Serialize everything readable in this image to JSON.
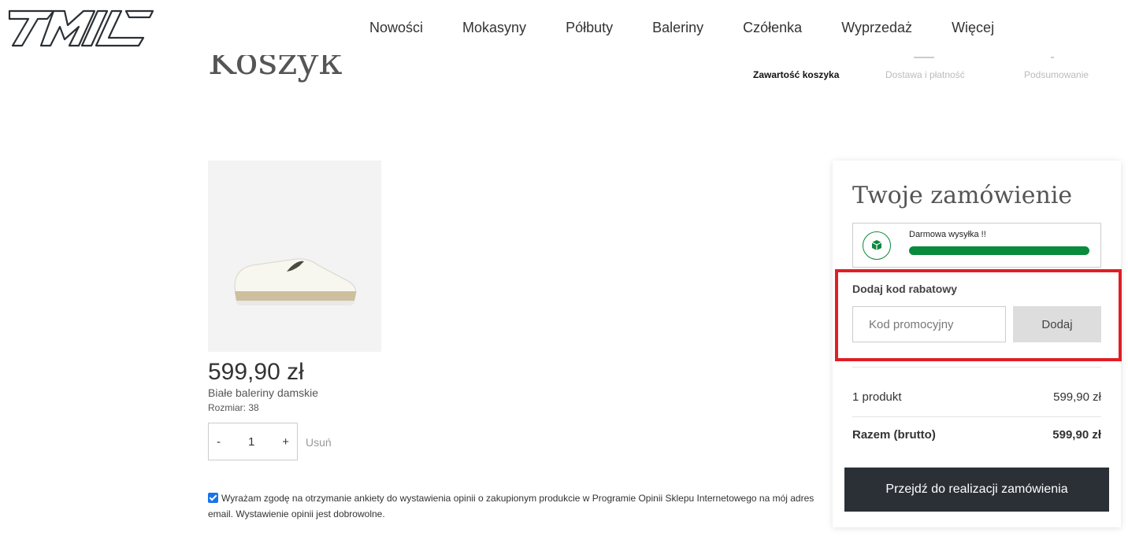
{
  "header": {
    "logo_text": "TMIL",
    "nav": [
      "Nowości",
      "Mokasyny",
      "Półbuty",
      "Baleriny",
      "Czółenka",
      "Wyprzedaż",
      "Więcej"
    ]
  },
  "page": {
    "title": "Koszyk",
    "steps": [
      "Zawartość koszyka",
      "Dostawa i płatność",
      "Podsumowanie"
    ]
  },
  "product": {
    "price": "599,90 zł",
    "name": "Białe baleriny damskie",
    "size": "Rozmiar: 38",
    "quantity": "1",
    "minus": "-",
    "plus": "+",
    "remove": "Usuń"
  },
  "consent": {
    "checked": true,
    "text": "Wyrażam zgodę na otrzymanie ankiety do wystawienia opinii o zakupionym produkcie w Programie Opinii Sklepu Internetowego na mój adres email. Wystawienie opinii jest dobrowolne."
  },
  "order": {
    "title": "Twoje zamówienie",
    "shipping_label": "Darmowa wysyłka !!",
    "shipping_progress": 1.0,
    "discount_title": "Dodaj kod rabatowy",
    "promo_placeholder": "Kod promocyjny",
    "promo_button": "Dodaj",
    "summary": [
      {
        "label": "1 produkt",
        "value": "599,90 zł"
      },
      {
        "label": "Razem (brutto)",
        "value": "599,90 zł"
      }
    ],
    "checkout_button": "Przejdź do realizacji zamówienia"
  },
  "colors": {
    "accent_green": "#0a8a3c",
    "highlight_red": "#e01e26",
    "checkout_dark": "#2b3036"
  }
}
